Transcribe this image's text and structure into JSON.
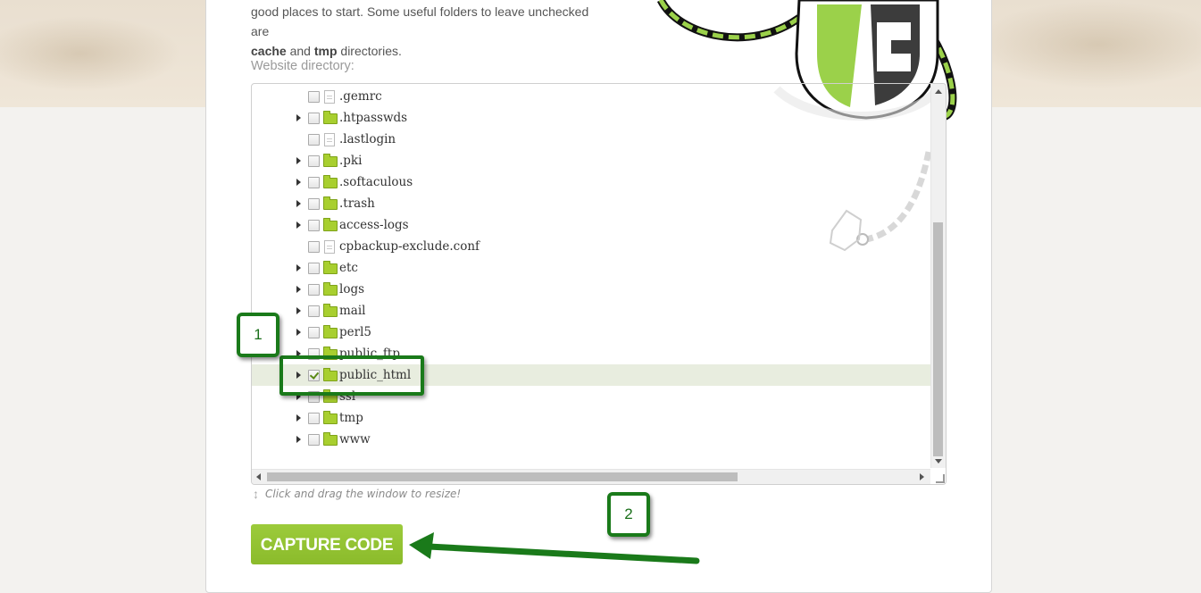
{
  "intro": {
    "line1": "good places to start. Some useful folders to leave unchecked are",
    "bold1": "cache",
    "and": " and ",
    "bold2": "tmp",
    "tail": " directories."
  },
  "directory_label": "Website directory:",
  "tree_rows": [
    {
      "name": ".gemrc",
      "type": "file",
      "expandable": false,
      "checked": false
    },
    {
      "name": ".htpasswds",
      "type": "folder",
      "expandable": true,
      "checked": false
    },
    {
      "name": ".lastlogin",
      "type": "file",
      "expandable": false,
      "checked": false
    },
    {
      "name": ".pki",
      "type": "folder",
      "expandable": true,
      "checked": false
    },
    {
      "name": ".softaculous",
      "type": "folder",
      "expandable": true,
      "checked": false
    },
    {
      "name": ".trash",
      "type": "folder",
      "expandable": true,
      "checked": false
    },
    {
      "name": "access-logs",
      "type": "folder",
      "expandable": true,
      "checked": false
    },
    {
      "name": "cpbackup-exclude.conf",
      "type": "file",
      "expandable": false,
      "checked": false
    },
    {
      "name": "etc",
      "type": "folder",
      "expandable": true,
      "checked": false
    },
    {
      "name": "logs",
      "type": "folder",
      "expandable": true,
      "checked": false
    },
    {
      "name": "mail",
      "type": "folder",
      "expandable": true,
      "checked": false
    },
    {
      "name": "perl5",
      "type": "folder",
      "expandable": true,
      "checked": false
    },
    {
      "name": "public_ftp",
      "type": "folder",
      "expandable": true,
      "checked": false
    },
    {
      "name": "public_html",
      "type": "folder",
      "expandable": true,
      "checked": true,
      "selected": true
    },
    {
      "name": "ssl",
      "type": "folder",
      "expandable": true,
      "checked": false
    },
    {
      "name": "tmp",
      "type": "folder",
      "expandable": true,
      "checked": false
    },
    {
      "name": "www",
      "type": "folder",
      "expandable": true,
      "checked": false
    }
  ],
  "resize_hint": "Click and drag the window to resize!",
  "capture_button": "CAPTURE CODE",
  "callouts": {
    "one": "1",
    "two": "2"
  },
  "colors": {
    "accent": "#8bbb2b",
    "callout": "#1a7a1a",
    "selected_row": "#e8eddf"
  }
}
